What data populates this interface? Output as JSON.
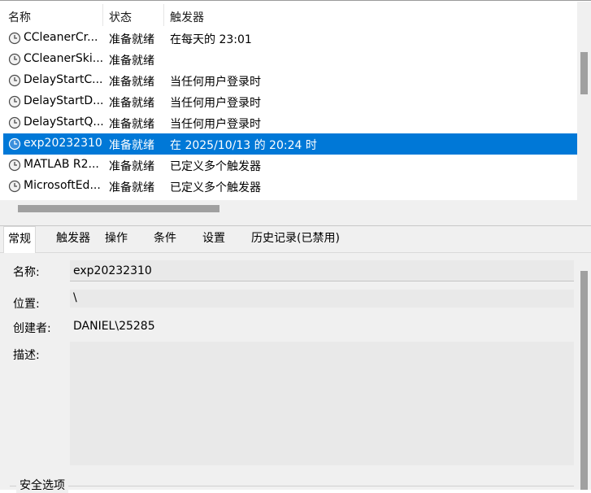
{
  "columns": {
    "name": "名称",
    "status": "状态",
    "trigger": "触发器"
  },
  "tasks": [
    {
      "name": "CCleanerCr...",
      "status": "准备就绪",
      "trigger": "在每天的 23:01",
      "selected": false
    },
    {
      "name": "CCleanerSki...",
      "status": "准备就绪",
      "trigger": "",
      "selected": false
    },
    {
      "name": "DelayStartC...",
      "status": "准备就绪",
      "trigger": "当任何用户登录时",
      "selected": false
    },
    {
      "name": "DelayStartD...",
      "status": "准备就绪",
      "trigger": "当任何用户登录时",
      "selected": false
    },
    {
      "name": "DelayStartQ...",
      "status": "准备就绪",
      "trigger": "当任何用户登录时",
      "selected": false
    },
    {
      "name": "exp20232310",
      "status": "准备就绪",
      "trigger": "在 2025/10/13 的 20:24 时",
      "selected": true
    },
    {
      "name": "MATLAB R2...",
      "status": "准备就绪",
      "trigger": "已定义多个触发器",
      "selected": false
    },
    {
      "name": "MicrosoftEd...",
      "status": "准备就绪",
      "trigger": "已定义多个触发器",
      "selected": false
    }
  ],
  "tabs": [
    "常规",
    "触发器",
    "操作",
    "条件",
    "设置",
    "历史记录(已禁用)"
  ],
  "general": {
    "name_label": "名称:",
    "name_value": "exp20232310",
    "location_label": "位置:",
    "location_value": "\\",
    "author_label": "创建者:",
    "author_value": "DANIEL\\25285",
    "description_label": "描述:",
    "description_value": "",
    "security_title": "安全选项"
  },
  "colors": {
    "selection": "#0078d7",
    "panel_bg": "#f0f0f0",
    "field_bg": "#e9e9e9"
  },
  "icons": {
    "task": "clock-icon"
  }
}
